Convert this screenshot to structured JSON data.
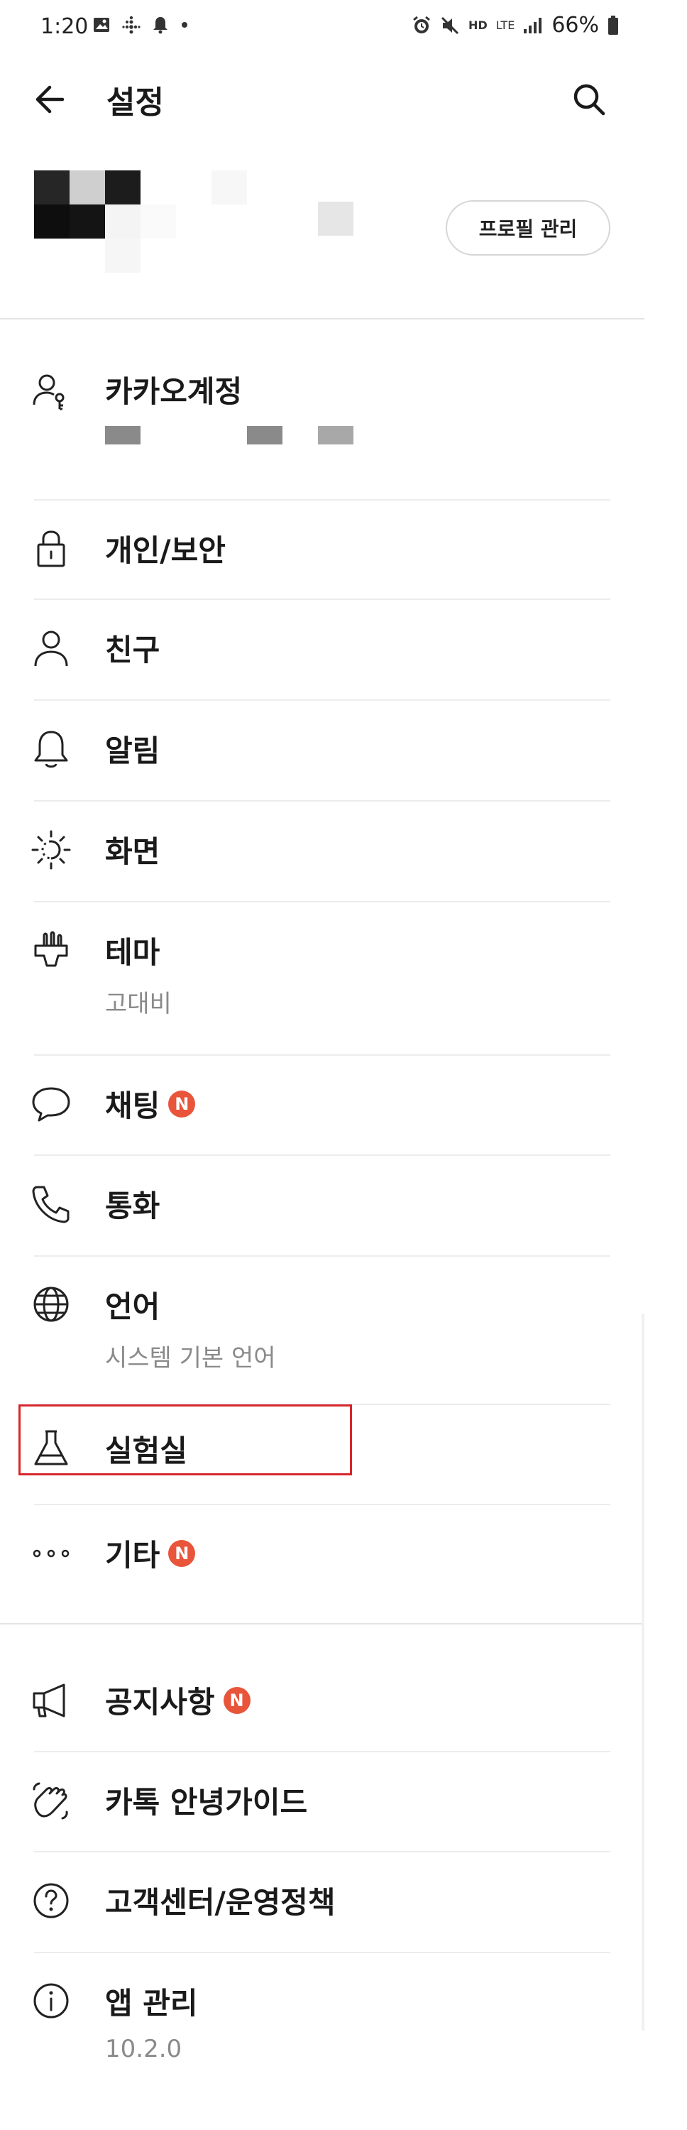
{
  "status_bar": {
    "time": "1:20",
    "battery_percent": "66%",
    "network": "LTE",
    "hd_label": "HD"
  },
  "header": {
    "title": "설정",
    "back_icon": "arrow-left-icon",
    "search_icon": "search-icon"
  },
  "profile": {
    "manage_label": "프로필 관리"
  },
  "settings": [
    {
      "id": "kakao-account",
      "label": "카카오계정",
      "icon": "account-key-icon"
    },
    {
      "id": "privacy-security",
      "label": "개인/보안",
      "icon": "lock-icon"
    },
    {
      "id": "friends",
      "label": "친구",
      "icon": "person-icon"
    },
    {
      "id": "notifications",
      "label": "알림",
      "icon": "bell-icon"
    },
    {
      "id": "display",
      "label": "화면",
      "icon": "brightness-icon"
    },
    {
      "id": "theme",
      "label": "테마",
      "sub": "고대비",
      "icon": "theme-brush-icon"
    },
    {
      "id": "chat",
      "label": "채팅",
      "badge": "N",
      "icon": "chat-bubble-icon"
    },
    {
      "id": "call",
      "label": "통화",
      "icon": "phone-icon"
    },
    {
      "id": "language",
      "label": "언어",
      "sub": "시스템 기본 언어",
      "icon": "globe-icon"
    },
    {
      "id": "lab",
      "label": "실험실",
      "icon": "flask-icon"
    },
    {
      "id": "etc",
      "label": "기타",
      "badge": "N",
      "icon": "more-dots-icon"
    }
  ],
  "support": [
    {
      "id": "notice",
      "label": "공지사항",
      "badge": "N",
      "icon": "megaphone-icon"
    },
    {
      "id": "guide",
      "label": "카톡 안녕가이드",
      "icon": "waving-hand-icon"
    },
    {
      "id": "help",
      "label": "고객센터/운영정책",
      "icon": "question-circle-icon"
    },
    {
      "id": "app-manage",
      "label": "앱 관리",
      "sub": "10.2.0",
      "icon": "info-circle-icon"
    }
  ],
  "colors": {
    "badge": "#e8553b",
    "highlight": "#d7262c",
    "text": "#1a1a1a",
    "subtext": "#8a8a8a"
  }
}
